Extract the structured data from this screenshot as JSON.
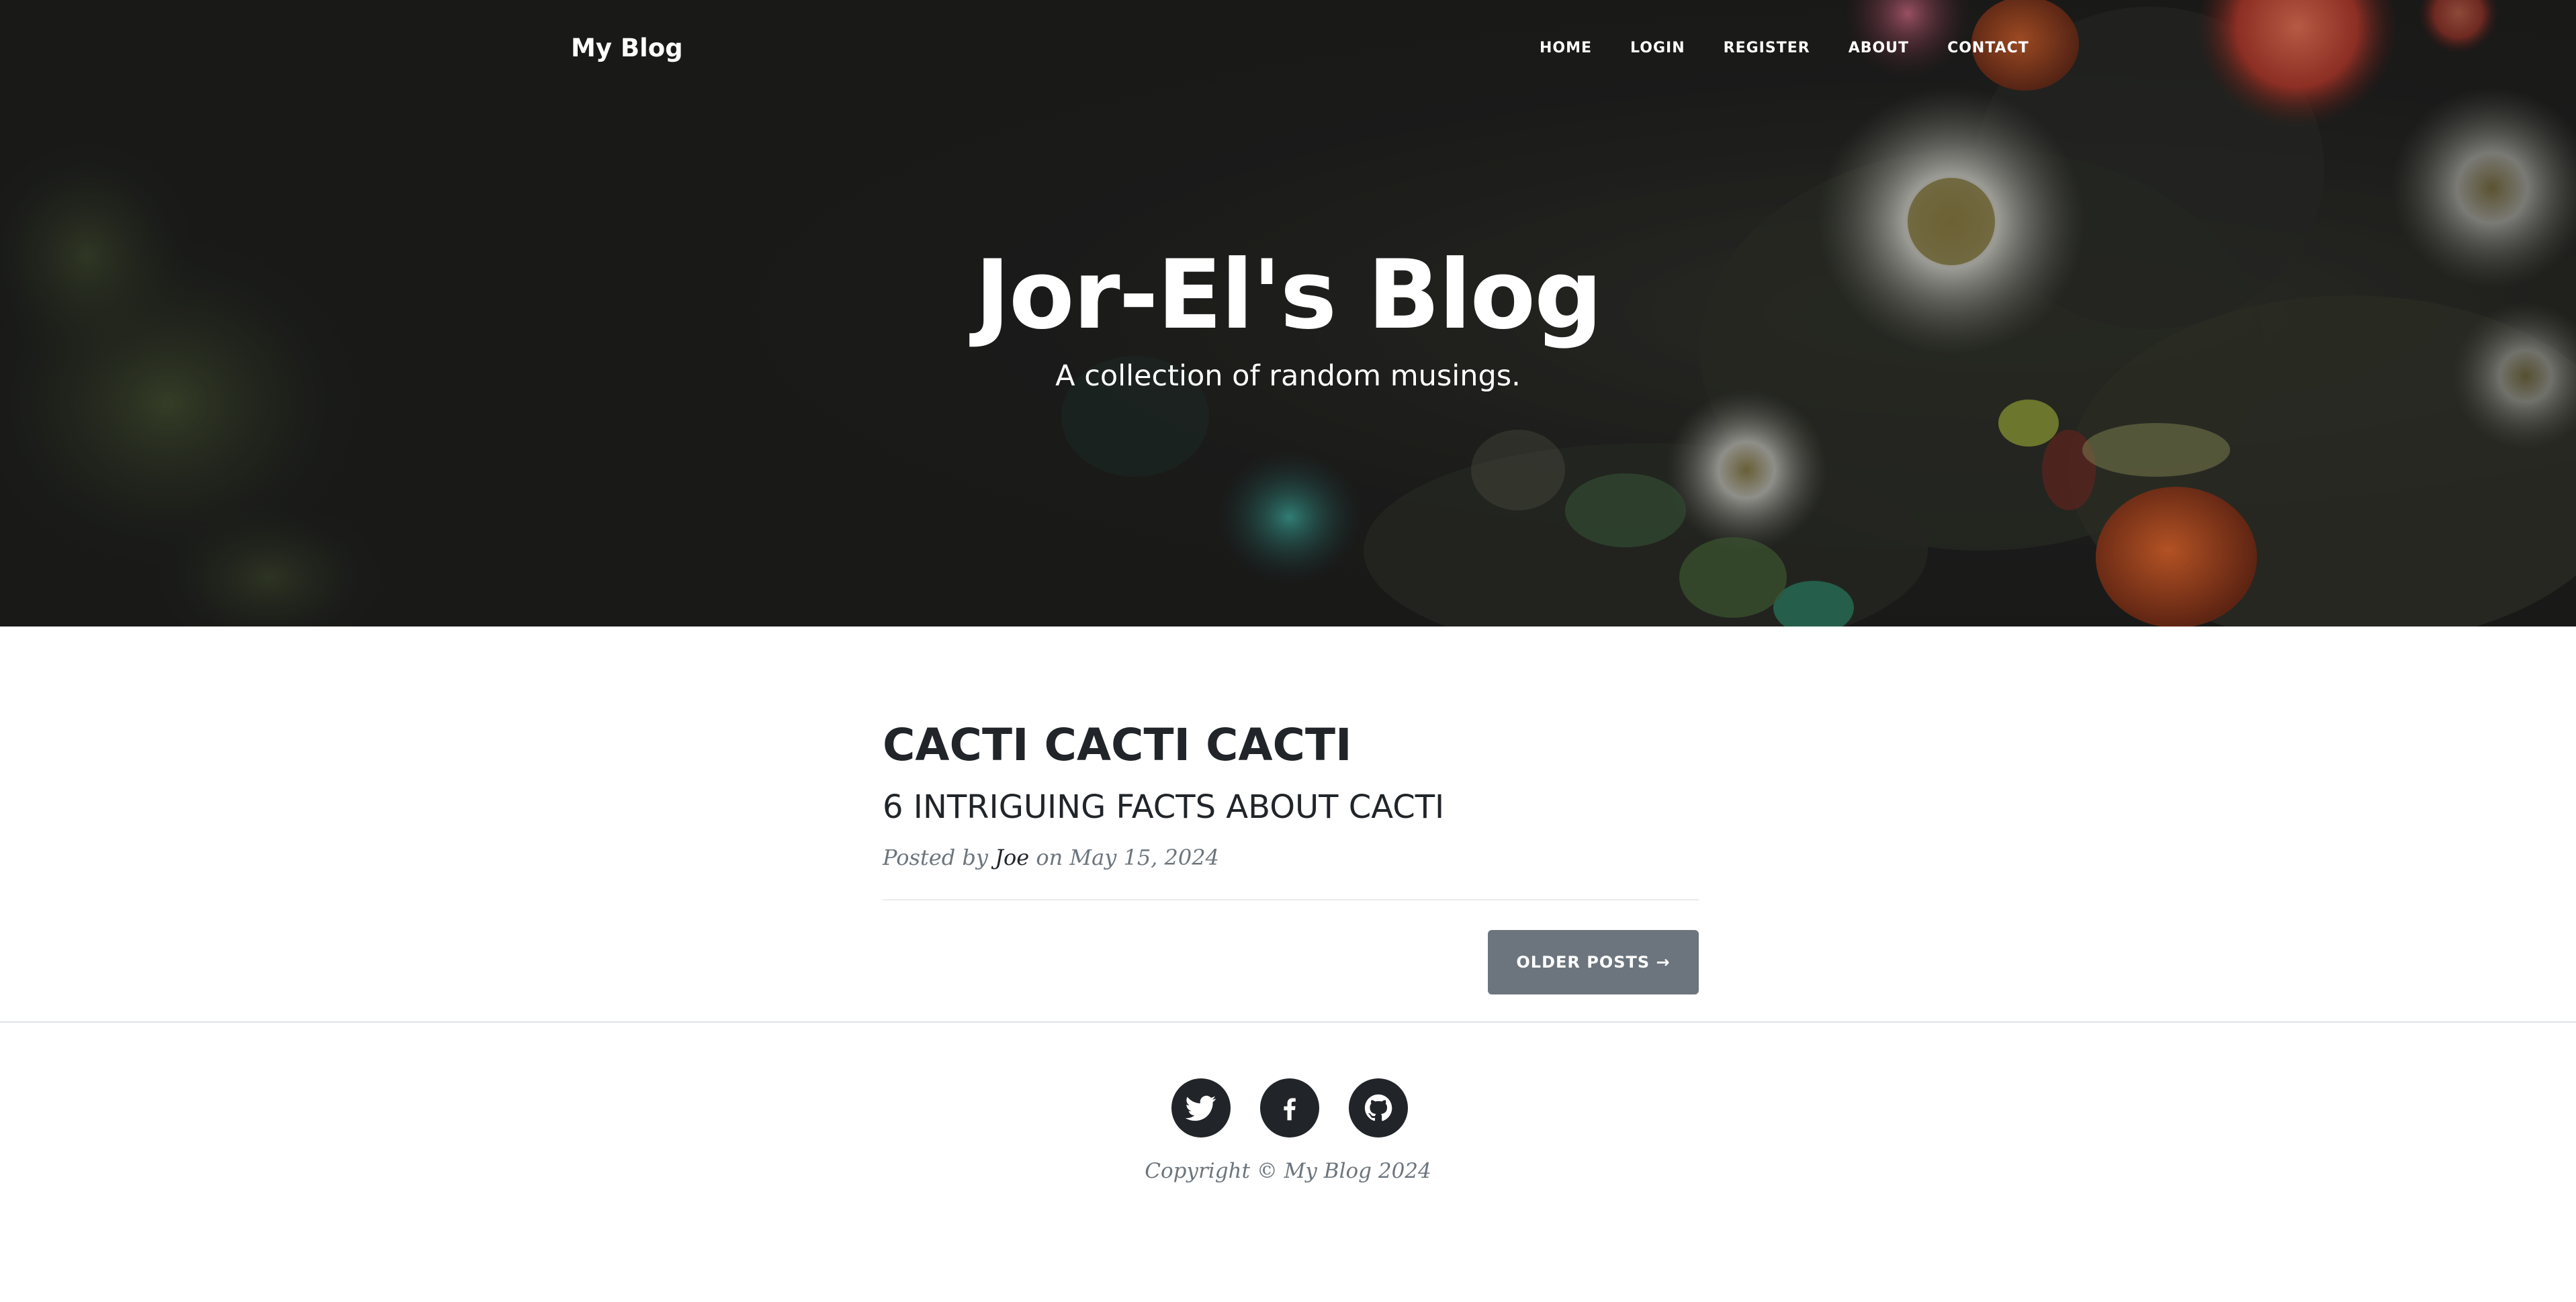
{
  "navbar": {
    "brand": "My Blog",
    "links": [
      {
        "label": "HOME"
      },
      {
        "label": "LOGIN"
      },
      {
        "label": "REGISTER"
      },
      {
        "label": "ABOUT"
      },
      {
        "label": "CONTACT"
      }
    ]
  },
  "header": {
    "title": "Jor-El's Blog",
    "subtitle": "A collection of random musings."
  },
  "posts": [
    {
      "title": "CACTI CACTI CACTI",
      "subtitle": "6 INTRIGUING FACTS ABOUT CACTI",
      "meta_prefix": "Posted by",
      "author": "Joe",
      "meta_date": "on May 15, 2024"
    }
  ],
  "pager": {
    "older_label": "OLDER POSTS →"
  },
  "footer": {
    "social": [
      {
        "icon": "twitter-icon"
      },
      {
        "icon": "facebook-icon"
      },
      {
        "icon": "github-icon"
      }
    ],
    "copyright": "Copyright © My Blog 2024"
  },
  "colors": {
    "text_dark": "#212529",
    "muted": "#6c757d",
    "button_bg": "#6c757d",
    "hero_bg": "#1a1a1a"
  }
}
